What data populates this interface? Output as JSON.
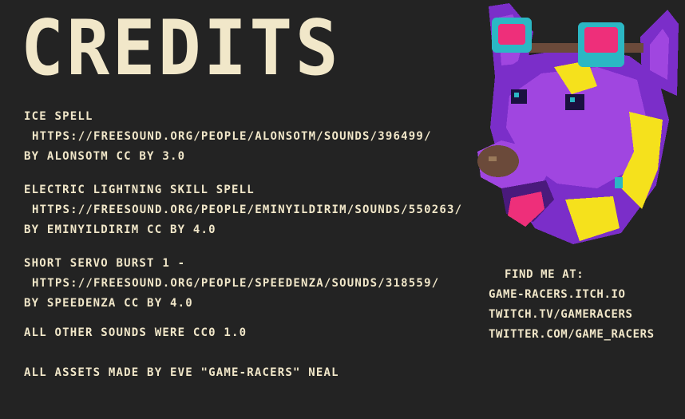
{
  "screen": {
    "title": "CREDITS"
  },
  "credits": [
    {
      "name": "ICE SPELL",
      "url": "HTTPS://FREESOUND.ORG/PEOPLE/ALONSOTM/SOUNDS/396499/",
      "attribution": "BY ALONSOTM CC BY 3.0"
    },
    {
      "name": "ELECTRIC LIGHTNING SKILL SPELL",
      "url": "HTTPS://FREESOUND.ORG/PEOPLE/EMINYILDIRIM/SOUNDS/550263/",
      "attribution": "BY EMINYILDIRIM CC BY 4.0"
    },
    {
      "name": "SHORT SERVO BURST 1 -",
      "url": "HTTPS://FREESOUND.ORG/PEOPLE/SPEEDENZA/SOUNDS/318559/",
      "attribution": "BY SPEEDENZA CC BY 4.0"
    }
  ],
  "other_sounds": "ALL OTHER SOUNDS WERE CC0 1.0",
  "assets_note": "ALL ASSETS MADE BY EVE \"GAME-RACERS\" NEAL",
  "social": {
    "heading": "FIND ME AT:",
    "links": [
      "GAME-RACERS.ITCH.IO",
      "TWITCH.TV/GAMERACERS",
      "TWITTER.COM/GAME_RACERS"
    ]
  },
  "portrait": {
    "icon": "pixel-art-dog-with-goggles",
    "colors": {
      "fur": "#7b2ec9",
      "fur_light": "#a046e0",
      "fur_shadow": "#4a1a7c",
      "highlight": "#f5e11c",
      "goggle_rim": "#2bb7c4",
      "goggle_lens": "#ee2f7a",
      "strap": "#6b4a3a",
      "nose": "#6b4a3a",
      "tongue": "#ee2f7a",
      "eye": "#1a1140"
    }
  },
  "theme": {
    "background": "#232323",
    "text": "#f1e7c9"
  }
}
